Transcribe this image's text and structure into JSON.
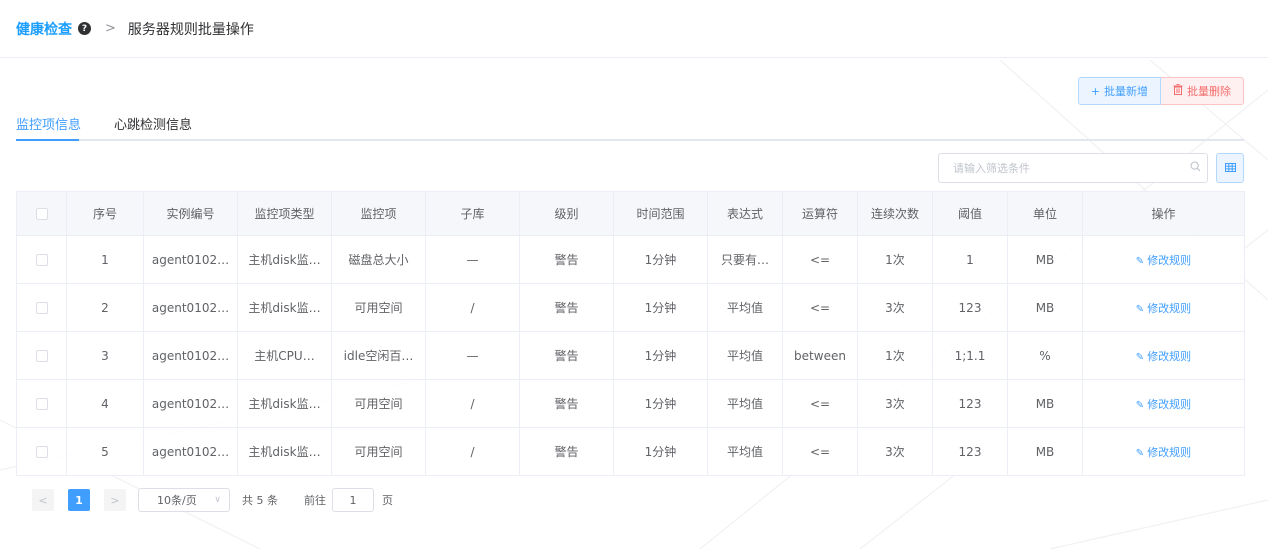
{
  "breadcrumb": {
    "title": "健康检查",
    "separator": ">",
    "current": "服务器规则批量操作"
  },
  "actions": {
    "add_label": "批量新增",
    "delete_label": "批量删除"
  },
  "tabs": [
    {
      "label": "监控项信息",
      "active": true
    },
    {
      "label": "心跳检测信息",
      "active": false
    }
  ],
  "search": {
    "placeholder": "请输入筛选条件"
  },
  "table": {
    "headers": [
      "序号",
      "实例编号",
      "监控项类型",
      "监控项",
      "子库",
      "级别",
      "时间范围",
      "表达式",
      "运算符",
      "连续次数",
      "阈值",
      "单位",
      "操作"
    ],
    "rows": [
      {
        "no": "1",
        "instance": "agent0102…",
        "type": "主机disk监…",
        "item": "磁盘总大小",
        "sub": "—",
        "level": "警告",
        "range": "1分钟",
        "expr": "只要有…",
        "op": "<=",
        "count": "1次",
        "threshold": "1",
        "unit": "MB",
        "action": "修改规则"
      },
      {
        "no": "2",
        "instance": "agent0102…",
        "type": "主机disk监…",
        "item": "可用空间",
        "sub": "/",
        "level": "警告",
        "range": "1分钟",
        "expr": "平均值",
        "op": "<=",
        "count": "3次",
        "threshold": "123",
        "unit": "MB",
        "action": "修改规则"
      },
      {
        "no": "3",
        "instance": "agent0102…",
        "type": "主机CPU…",
        "item": "idle空闲百…",
        "sub": "—",
        "level": "警告",
        "range": "1分钟",
        "expr": "平均值",
        "op": "between",
        "count": "1次",
        "threshold": "1;1.1",
        "unit": "%",
        "action": "修改规则"
      },
      {
        "no": "4",
        "instance": "agent0102…",
        "type": "主机disk监…",
        "item": "可用空间",
        "sub": "/",
        "level": "警告",
        "range": "1分钟",
        "expr": "平均值",
        "op": "<=",
        "count": "3次",
        "threshold": "123",
        "unit": "MB",
        "action": "修改规则"
      },
      {
        "no": "5",
        "instance": "agent0102…",
        "type": "主机disk监…",
        "item": "可用空间",
        "sub": "/",
        "level": "警告",
        "range": "1分钟",
        "expr": "平均值",
        "op": "<=",
        "count": "3次",
        "threshold": "123",
        "unit": "MB",
        "action": "修改规则"
      }
    ]
  },
  "pagination": {
    "prev": "<",
    "current_page": "1",
    "next": ">",
    "page_size": "10条/页",
    "total": "共 5 条",
    "goto_label": "前往",
    "goto_value": "1",
    "page_suffix": "页"
  },
  "colors": {
    "accent": "#409eff",
    "title": "#1e9fff",
    "danger": "#f56c6c"
  }
}
